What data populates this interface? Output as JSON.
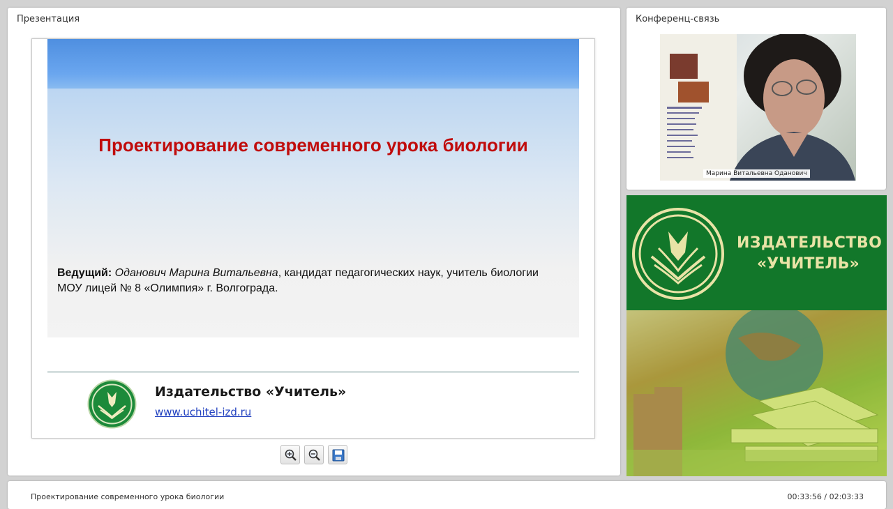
{
  "presentation": {
    "panel_title": "Презентация",
    "slide": {
      "title": "Проектирование современного урока биологии",
      "presenter_label": "Ведущий:",
      "presenter_name": "Оданович Марина Витальевна",
      "presenter_rest": ", кандидат педагогических наук, учитель биологии",
      "presenter_line2": "МОУ лицей № 8 «Олимпия» г. Волгограда.",
      "publisher_name": "Издательство «Учитель»",
      "publisher_url": "www.uchitel-izd.ru"
    },
    "toolbar": {
      "zoom_in": "zoom-in-icon",
      "zoom_out": "zoom-out-icon",
      "save": "save-icon"
    }
  },
  "conference": {
    "panel_title": "Конференц-связь",
    "participant_name": "Марина Витальевна Оданович"
  },
  "brand": {
    "line1": "ИЗДАТЕЛЬСТВО",
    "line2": "«УЧИТЕЛЬ»"
  },
  "footer": {
    "title": "Проектирование современного урока биологии",
    "time": "00:33:56 / 02:03:33"
  },
  "colors": {
    "slide_title": "#c00c0c",
    "brand_green": "#12772a",
    "brand_text": "#e9e3a6",
    "link": "#1f3fbf"
  }
}
